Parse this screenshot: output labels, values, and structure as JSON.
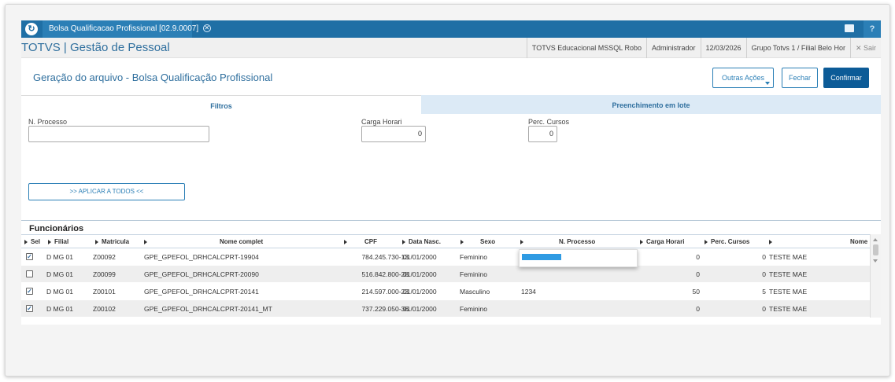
{
  "window": {
    "tab_title": "Bolsa Qualificacao Profissional [02.9.0007]",
    "close_symbol": "✕",
    "logo_glyph": "↻",
    "help_glyph": "?",
    "mail_icon": "mail-icon",
    "accent_color": "#1f6fa5"
  },
  "product": {
    "title": "TOTVS | Gestão de Pessoal",
    "environment": "TOTVS Educacional MSSQL Robo",
    "user": "Administrador",
    "date": "12/03/2026",
    "branch": "Grupo Totvs 1 / Filial Belo Hor",
    "exit_label": "✕  Sair"
  },
  "page": {
    "title": "Geração do arquivo - Bolsa Qualificação Profissional",
    "actions": {
      "more_label": "Outras Ações",
      "close_label": "Fechar",
      "confirm_label": "Confirmar"
    }
  },
  "tabs": [
    {
      "label": "Filtros",
      "active": true
    },
    {
      "label": "Preenchimento em lote",
      "active": false
    }
  ],
  "form": {
    "process_label": "N. Processo",
    "process_value": "",
    "hours_label": "Carga Horari",
    "hours_value": "0",
    "courses_label": "Perc. Cursos",
    "courses_value": "0",
    "apply_label": ">> APLICAR A TODOS <<"
  },
  "grid": {
    "title": "Funcionários",
    "columns": [
      "Sel",
      "Filial",
      "Matricula",
      "Nome complet",
      "CPF",
      "Data Nasc.",
      "Sexo",
      "N. Processo",
      "Carga Horari",
      "Perc. Cursos",
      "Nome"
    ],
    "rows": [
      {
        "checked": "✓",
        "filial": "D MG 01",
        "matricula": "Z00092",
        "nome": "GPE_GPEFOL_DRHCALCPRT-19904",
        "cpf": "784.245.730-13",
        "nasc": "01/01/2000",
        "sexo": "Feminino",
        "processo": "",
        "carga": "0",
        "perc": "0",
        "nome_mae": "TESTE MAE"
      },
      {
        "checked": "",
        "filial": "D MG 01",
        "matricula": "Z00099",
        "nome": "GPE_GPEFOL_DRHCALCPRT-20090",
        "cpf": "516.842.800-28",
        "nasc": "01/01/2000",
        "sexo": "Feminino",
        "processo": "",
        "carga": "0",
        "perc": "0",
        "nome_mae": "TESTE MAE"
      },
      {
        "checked": "✓",
        "filial": "D MG 01",
        "matricula": "Z00101",
        "nome": "GPE_GPEFOL_DRHCALCPRT-20141",
        "cpf": "214.597.000-23",
        "nasc": "01/01/2000",
        "sexo": "Masculino",
        "processo": "1234",
        "carga": "50",
        "perc": "5",
        "nome_mae": "TESTE MAE"
      },
      {
        "checked": "✓",
        "filial": "D MG 01",
        "matricula": "Z00102",
        "nome": "GPE_GPEFOL_DRHCALCPRT-20141_MT",
        "cpf": "737.229.050-36",
        "nasc": "01/01/2000",
        "sexo": "Feminino",
        "processo": "",
        "carga": "0",
        "perc": "0",
        "nome_mae": "TESTE MAE"
      }
    ]
  }
}
